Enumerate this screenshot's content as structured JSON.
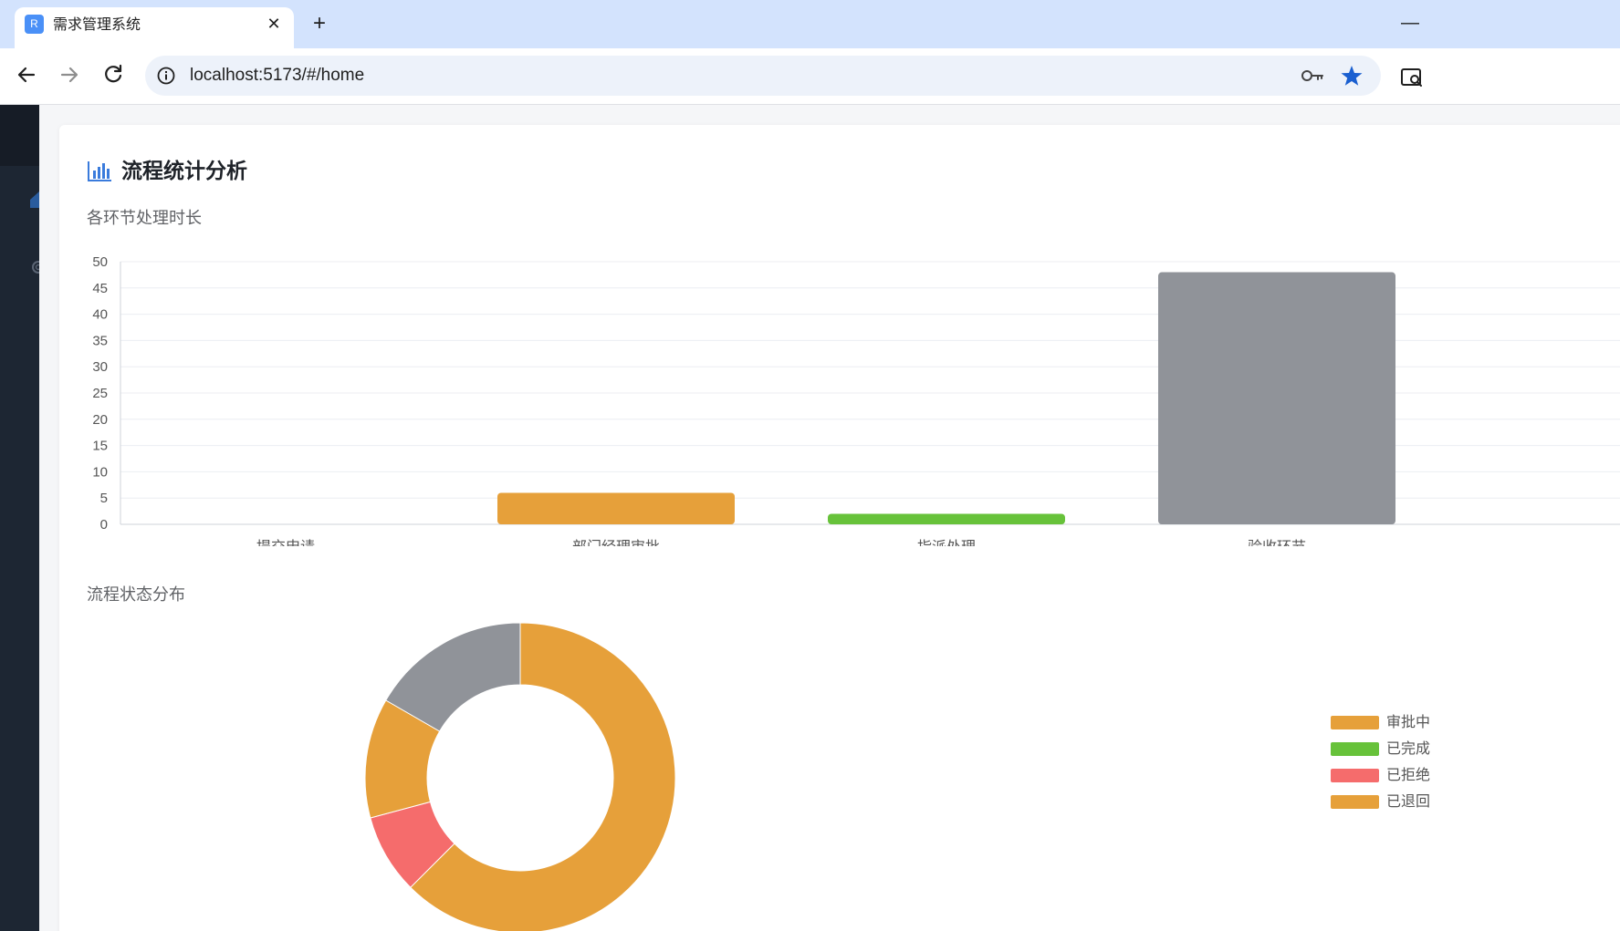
{
  "browser": {
    "tab": {
      "favicon_letter": "R",
      "title": "需求管理系统",
      "close_glyph": "✕"
    },
    "new_tab_glyph": "+",
    "minimize_glyph": "—",
    "url": "localhost:5173/#/home"
  },
  "page": {
    "title": "流程统计分析",
    "bar_section_title": "各环节处理时长",
    "pie_section_title": "流程状态分布"
  },
  "chart_data": [
    {
      "type": "bar",
      "title": "各环节处理时长",
      "categories": [
        "提交申请",
        "部门经理审批",
        "指派处理",
        "验收环节"
      ],
      "values": [
        0,
        6,
        2,
        48
      ],
      "colors": [
        "#e6a03a",
        "#e6a03a",
        "#67c23a",
        "#909399"
      ],
      "ylim": [
        0,
        50
      ],
      "yticks": [
        0,
        5,
        10,
        15,
        20,
        25,
        30,
        35,
        40,
        45,
        50
      ],
      "grid": true
    },
    {
      "type": "pie",
      "title": "流程状态分布",
      "donut": true,
      "slices": [
        {
          "label": "审批中",
          "value": 15,
          "color": "#e6a03a"
        },
        {
          "label": "已完成",
          "value": 0,
          "color": "#67c23a"
        },
        {
          "label": "已拒绝",
          "value": 2,
          "color": "#f56c6c"
        },
        {
          "label": "已退回",
          "value": 3,
          "color": "#e6a03a"
        },
        {
          "label": "",
          "value": 4,
          "color": "#909399"
        }
      ],
      "legend": [
        "审批中",
        "已完成",
        "已拒绝",
        "已退回"
      ],
      "legend_position": "right"
    }
  ]
}
